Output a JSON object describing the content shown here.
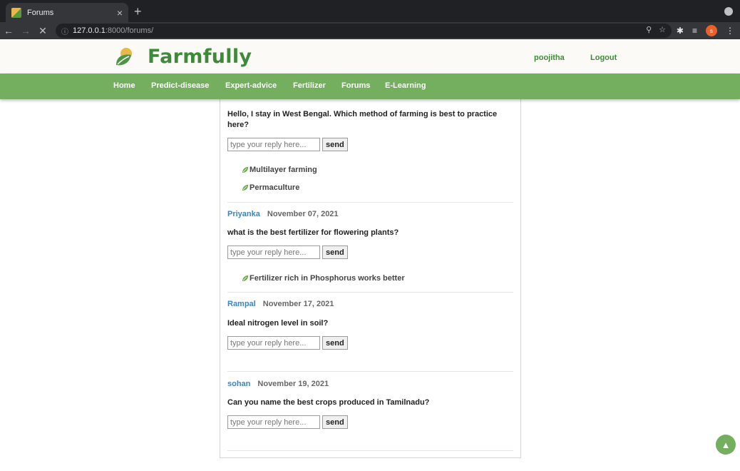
{
  "browser": {
    "tab_title": "Forums",
    "tab_close": "×",
    "new_tab": "+",
    "url_host": "127.0.0.1",
    "url_path": ":8000/forums/",
    "profile_initial": "s"
  },
  "site": {
    "brand": "Farmfully",
    "user": "poojitha",
    "logout": "Logout"
  },
  "nav": [
    "Home",
    "Predict-disease",
    "Expert-advice",
    "Fertilizer",
    "Forums",
    "E-Learning"
  ],
  "reply": {
    "placeholder": "type your reply here...",
    "send": "send"
  },
  "posts": [
    {
      "question": "Hello, I stay in West Bengal. Which method of farming is best to practice here?",
      "answers": [
        "Multilayer farming",
        "Permaculture"
      ]
    },
    {
      "author": "Priyanka",
      "date": "November 07, 2021",
      "question": "what is the best fertilizer for flowering plants?",
      "answers": [
        "Fertilizer rich in Phosphorus works better"
      ]
    },
    {
      "author": "Rampal",
      "date": "November 17, 2021",
      "question": "Ideal nitrogen level in soil?",
      "answers": []
    },
    {
      "author": "sohan",
      "date": "November 19, 2021",
      "question": "Can you name the best crops produced in Tamilnadu?",
      "answers": []
    }
  ],
  "colors": {
    "brand_green": "#3f8a3a",
    "nav_green": "#74ae5f",
    "author_blue": "#3b82d0"
  },
  "icons": {
    "scroll_top": "arrow-up-icon",
    "leaf": "leaf-icon",
    "logo": "farm-logo-icon"
  }
}
